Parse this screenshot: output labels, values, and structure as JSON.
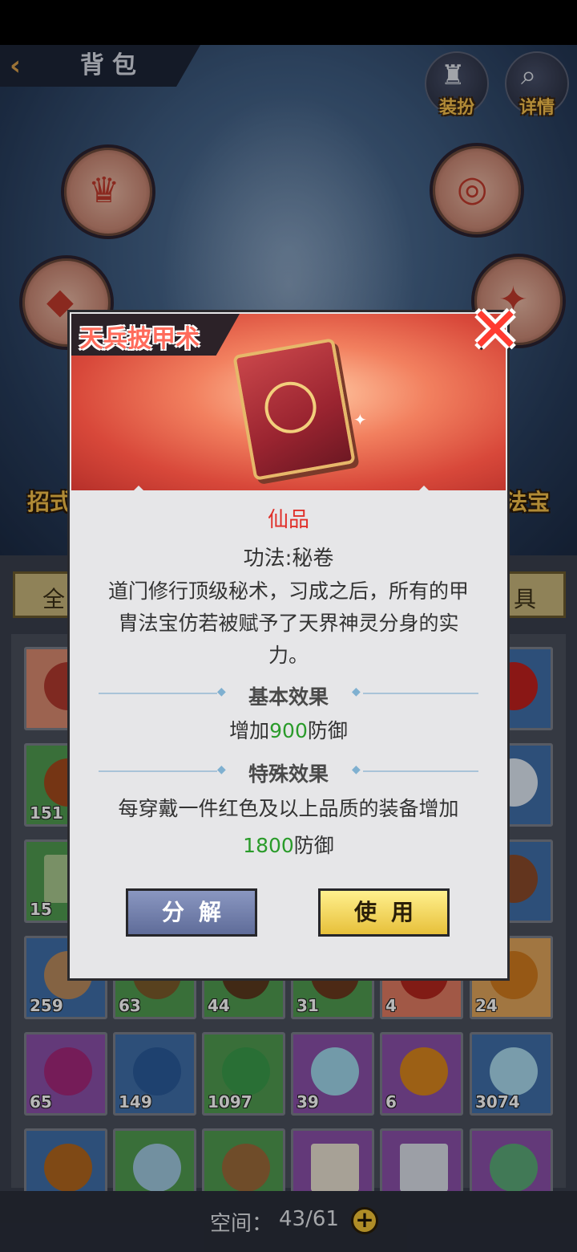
{
  "header": {
    "back_icon": "chevron-left-icon",
    "title": "背包",
    "dress_label": "装扮",
    "detail_label": "详情"
  },
  "side_labels": {
    "left": "招式",
    "right": "法宝"
  },
  "tabs": {
    "left": "全",
    "right": "具"
  },
  "inventory": {
    "counts": [
      "151",
      "15",
      "259",
      "63",
      "44",
      "31",
      "4",
      "24",
      "65",
      "149",
      "1097",
      "39",
      "6",
      "3074"
    ]
  },
  "footer": {
    "space_label": "空间：",
    "space_value": "43/61"
  },
  "modal": {
    "item_name": "天兵披甲术",
    "quality": "仙品",
    "category": "功法:秘卷",
    "description": "道门修行顶级秘术，习成之后，所有的甲胄法宝仿若被赋予了天界神灵分身的实力。",
    "basic_title": "基本效果",
    "basic_prefix": "增加",
    "basic_value": "900",
    "basic_suffix": "防御",
    "special_title": "特殊效果",
    "special_prefix": "每穿戴一件红色及以上品质的装备增加",
    "special_value": "1800",
    "special_suffix": "防御",
    "decompose_label": "分解",
    "use_label": "使用"
  },
  "colors": {
    "quality_red": "#e0302a",
    "effect_green": "#2a9b2a",
    "accent_gold": "#f3c437"
  }
}
